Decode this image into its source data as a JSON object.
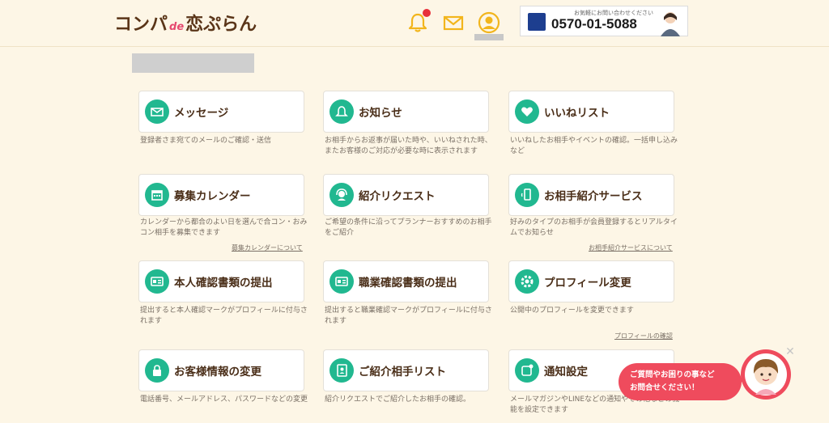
{
  "header": {
    "logo_part1": "コンパ",
    "logo_part2": "de",
    "logo_part3": "恋ぷらん",
    "phone_caption": "お気軽にお問い合わせください",
    "phone_number": "0570-01-5088"
  },
  "cards": [
    {
      "title": "メッセージ",
      "desc": "登録者さま宛てのメールのご確認・送信",
      "icon": "envelope-icon"
    },
    {
      "title": "お知らせ",
      "desc": "お相手からお返事が届いた時や、いいねされた時、またお客様のご対応が必要な時に表示されます",
      "icon": "bell-icon"
    },
    {
      "title": "いいねリスト",
      "desc": "いいねしたお相手やイベントの確認。一括申し込みなど",
      "icon": "heart-icon"
    },
    {
      "title": "募集カレンダー",
      "desc": "カレンダーから都合のよい日を選んで合コン・おみコン相手を募集できます",
      "icon": "calendar-icon",
      "link": "募集カレンダーについて"
    },
    {
      "title": "紹介リクエスト",
      "desc": "ご希望の条件に沿ってプランナーおすすめのお相手をご紹介",
      "icon": "planner-icon"
    },
    {
      "title": "お相手紹介サービス",
      "desc": "好みのタイプのお相手が会員登録するとリアルタイムでお知らせ",
      "icon": "smartphone-icon",
      "link": "お相手紹介サービスについて"
    },
    {
      "title": "本人確認書類の提出",
      "desc": "提出すると本人確認マークがプロフィールに付与されます",
      "icon": "id-card-icon"
    },
    {
      "title": "職業確認書類の提出",
      "desc": "提出すると職業確認マークがプロフィールに付与されます",
      "icon": "id-card-icon"
    },
    {
      "title": "プロフィール変更",
      "desc": "公開中のプロフィールを変更できます",
      "icon": "gear-icon",
      "link": "プロフィールの確認"
    },
    {
      "title": "お客様情報の変更",
      "desc": "電話番号、メールアドレス、パスワードなどの変更",
      "icon": "lock-icon"
    },
    {
      "title": "ご紹介相手リスト",
      "desc": "紹介リクエストでご紹介したお相手の確認。",
      "icon": "address-book-icon"
    },
    {
      "title": "通知設定",
      "desc": "メールマガジンやLINEなどの通知やその他などの機能を設定できます",
      "icon": "notification-icon"
    }
  ],
  "chat": {
    "line1": "ご質問やお困りの事など",
    "line2": "お問合せください！"
  },
  "colors": {
    "accent_green": "#21b890",
    "bell_yellow": "#f2b51c",
    "chat_red": "#ef4b5d",
    "brand_brown": "#4a2e18"
  }
}
